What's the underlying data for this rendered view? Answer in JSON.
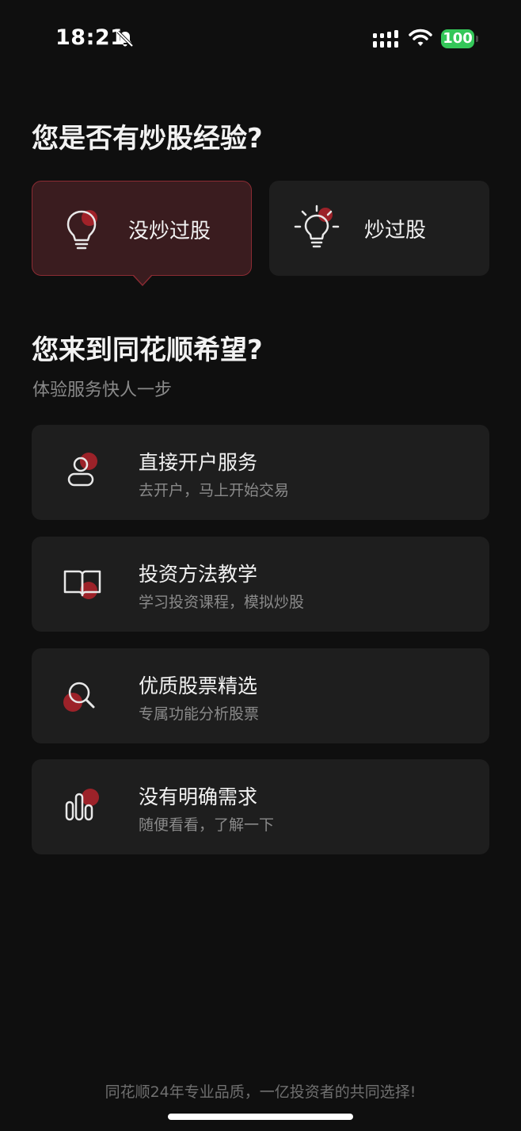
{
  "status_bar": {
    "time": "18:21",
    "battery": "100",
    "battery_color": "#34c759"
  },
  "experience": {
    "question": "您是否有炒股经验?",
    "options": [
      {
        "label": "没炒过股",
        "selected": true,
        "icon": "lightbulb-off-icon"
      },
      {
        "label": "炒过股",
        "selected": false,
        "icon": "lightbulb-on-icon"
      }
    ]
  },
  "goals": {
    "question": "您来到同花顺希望?",
    "subtitle": "体验服务快人一步",
    "items": [
      {
        "title": "直接开户服务",
        "desc": "去开户，马上开始交易",
        "icon": "user-icon"
      },
      {
        "title": "投资方法教学",
        "desc": "学习投资课程，模拟炒股",
        "icon": "book-icon"
      },
      {
        "title": "优质股票精选",
        "desc": "专属功能分析股票",
        "icon": "magnifier-icon"
      },
      {
        "title": "没有明确需求",
        "desc": "随便看看，了解一下",
        "icon": "bar-chart-icon"
      }
    ]
  },
  "footer": "同花顺24年专业品质，一亿投资者的共同选择!",
  "colors": {
    "background": "#0f0f0f",
    "card": "#1e1e1e",
    "selected_card": "#3a1c1f",
    "selected_border": "#8c2b33",
    "accent": "#c0262f"
  }
}
